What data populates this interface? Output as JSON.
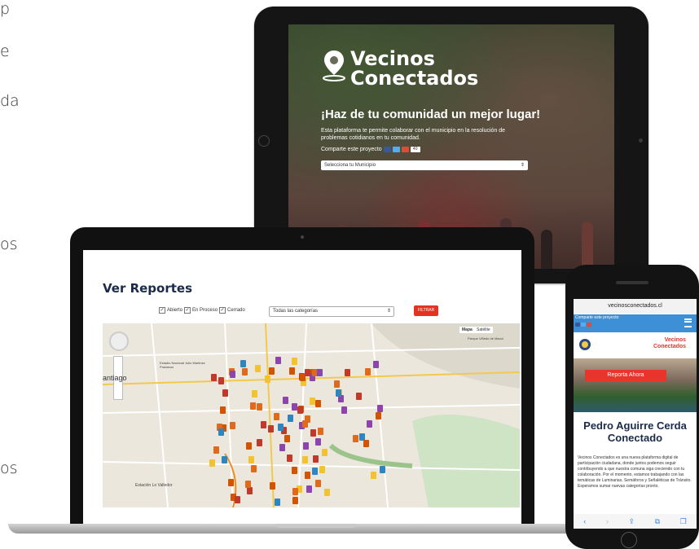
{
  "side_fragments": [
    "e",
    "da",
    "os",
    "os",
    "p"
  ],
  "tablet": {
    "logo": [
      "Vecinos",
      "Conectados"
    ],
    "tagline": "¡Haz de tu comunidad un mejor lugar!",
    "description": "Esta plataforma te permite colaborar con el municipio en la resolución de problemas cotidianos en tu comunidad.",
    "share_label": "Comparte este proyecto",
    "share_count": "40",
    "municipio_placeholder": "Selecciona tu Municipio"
  },
  "laptop": {
    "title": "Ver Reportes",
    "filters": [
      "Abierto",
      "En Proceso",
      "Cerrado"
    ],
    "category_select": "Todas las categorías",
    "filter_button": "FILTRAR",
    "map_types": [
      "Mapa",
      "Satélite"
    ],
    "map_labels": [
      "antiago",
      "Estadio Nacional Julio Martinez Prádanos",
      "Parque Viñedo de Macul",
      "Estación Lo Valledor"
    ]
  },
  "phone": {
    "url": "vecinosconectados.cl",
    "share_label": "Comparte este proyecto",
    "logo": [
      "Vecinos",
      "Conectados"
    ],
    "cta": "Reporta Ahora",
    "title": "Pedro Aguirre Cerda Conectado",
    "body": "Vecinos Conectados es una nueva plataforma digital de participación ciudadana, donde juntos podemos seguir contribuyendo a que nuestra comuna siga creciendo con tu colaboración. Por el momento, estamos trabajando con las temáticas de Luminarias, Semáforos y Señaléticas de Tránsito. Esperamos sumar nuevas categorías pronto."
  },
  "colors": {
    "accent": "#e53323",
    "phone_bar": "#3d8fd6",
    "title_navy": "#1a2a4a"
  }
}
